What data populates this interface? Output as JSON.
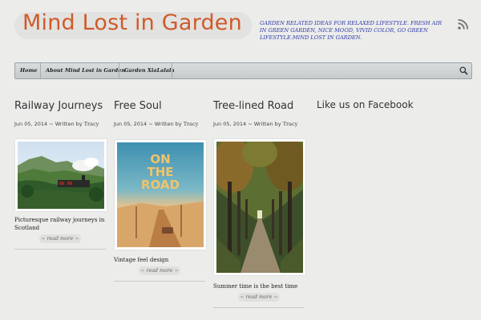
{
  "header": {
    "site_title": "Mind Lost in Garden",
    "tagline": "Garden related ideas for relaxed lifestyle. Fresh air in green garden, nice mood, vivid color, go green lifestyle.Mind lost in garden."
  },
  "nav": {
    "items": [
      {
        "label": "Home"
      },
      {
        "label": "About Mind Lost in Garden"
      },
      {
        "label": "Garden XiaLalala"
      }
    ]
  },
  "posts": [
    {
      "title": "Railway Journeys",
      "date": "Jun 05, 2014",
      "written_by": "~ Written by",
      "author": "Tracy",
      "excerpt": "Picturesque railway journeys in Scotland",
      "read_more": "~ read more ~"
    },
    {
      "title": "Free Soul",
      "date": "Jun 05, 2014",
      "written_by": "~ Written by",
      "author": "Tracy",
      "excerpt": "Vintage feel design",
      "read_more": "~ read more ~",
      "image_text_line1": "ON",
      "image_text_line2": "THE",
      "image_text_line3": "ROAD"
    },
    {
      "title": "Tree-lined Road",
      "date": "Jun 05, 2014",
      "written_by": "~ Written by",
      "author": "Tracy",
      "excerpt": "Summer time is the best time",
      "read_more": "~ read more ~"
    }
  ],
  "sidebar": {
    "widget_title": "Like us on Facebook"
  },
  "colors": {
    "title": "#d05a2a",
    "tagline": "#2b3aa8",
    "background": "#ececeb"
  }
}
